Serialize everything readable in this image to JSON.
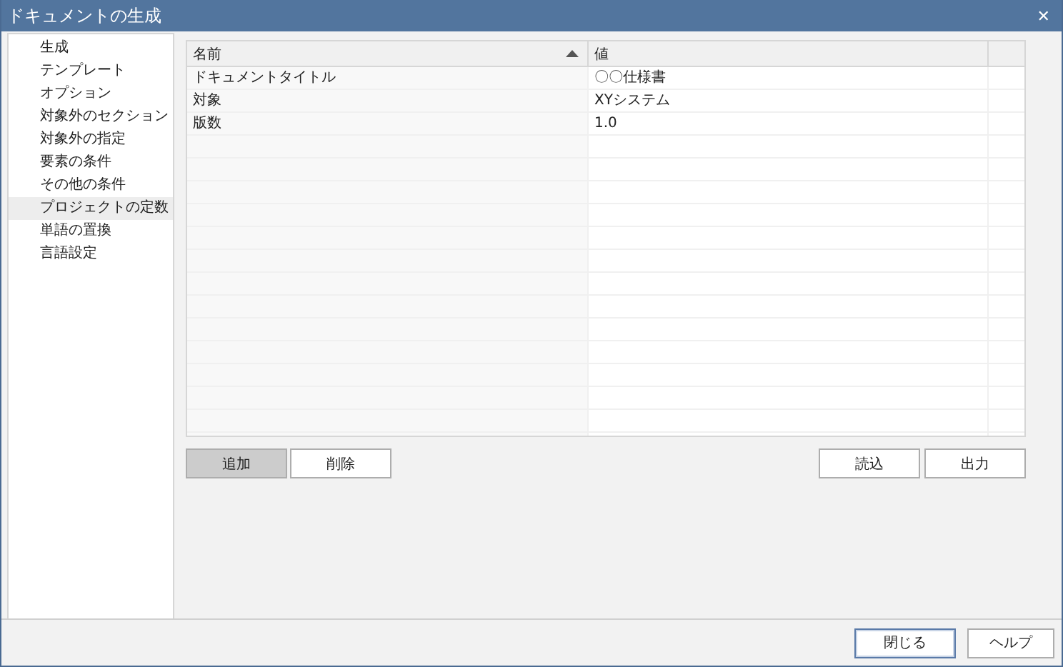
{
  "window": {
    "title": "ドキュメントの生成",
    "close": "✕"
  },
  "sidebar": {
    "items": [
      {
        "label": "生成",
        "selected": false
      },
      {
        "label": "テンプレート",
        "selected": false
      },
      {
        "label": "オプション",
        "selected": false
      },
      {
        "label": "対象外のセクション",
        "selected": false
      },
      {
        "label": "対象外の指定",
        "selected": false
      },
      {
        "label": "要素の条件",
        "selected": false
      },
      {
        "label": "その他の条件",
        "selected": false
      },
      {
        "label": "プロジェクトの定数",
        "selected": true
      },
      {
        "label": "単語の置換",
        "selected": false
      },
      {
        "label": "言語設定",
        "selected": false
      }
    ]
  },
  "table": {
    "columns": [
      {
        "label": "名前",
        "sorted_ascending": true
      },
      {
        "label": "値",
        "sorted_ascending": false
      }
    ],
    "rows": [
      [
        "ドキュメントタイトル",
        "〇〇仕様書"
      ],
      [
        "対象",
        "XYシステム"
      ],
      [
        "版数",
        "1.0"
      ]
    ]
  },
  "left_buttons": [
    {
      "label": "追加",
      "pressed": true
    },
    {
      "label": "削除",
      "pressed": false
    }
  ],
  "right_buttons": [
    {
      "label": "読込",
      "pressed": false
    },
    {
      "label": "出力",
      "pressed": false
    }
  ],
  "footer_buttons": [
    {
      "label": "閉じる",
      "default": true
    },
    {
      "label": "ヘルプ",
      "default": false
    }
  ]
}
